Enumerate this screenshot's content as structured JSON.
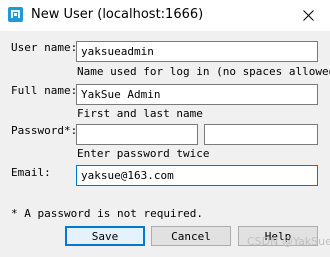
{
  "window": {
    "title": "New User (localhost:1666)",
    "icon": "p4-app-icon",
    "close_icon": "close-icon"
  },
  "form": {
    "user_name": {
      "label": "User name:",
      "value": "yaksueadmin",
      "hint": "Name used for log in (no spaces allowed)"
    },
    "full_name": {
      "label": "Full name:",
      "value": "YakSue Admin",
      "hint": "First and last name"
    },
    "password": {
      "label": "Password*:",
      "value": "",
      "confirm_value": "",
      "hint": "Enter password twice"
    },
    "email": {
      "label": "Email:",
      "value": "yaksue@163.com"
    }
  },
  "note": "* A password is not required.",
  "buttons": {
    "save": "Save",
    "cancel": "Cancel",
    "help": "Help"
  },
  "watermark": "CSDN @YakSue",
  "colors": {
    "accent": "#0078d7",
    "dialog_bg": "#f0f0f0",
    "app_icon": "#1e9bd7"
  }
}
